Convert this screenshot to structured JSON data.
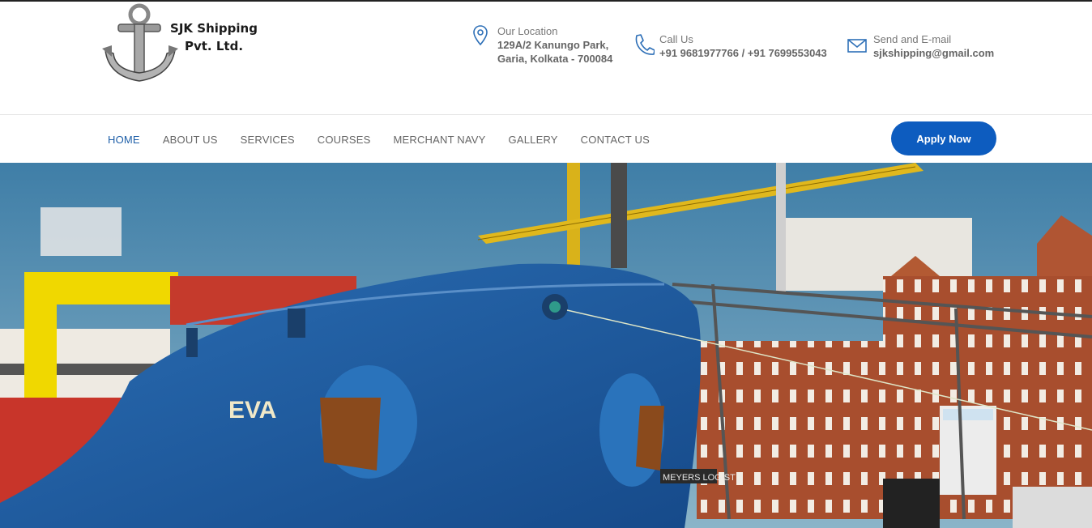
{
  "brand": {
    "line1": "SJK Shipping",
    "line2": "Pvt. Ltd."
  },
  "contacts": [
    {
      "icon": "location-pin-icon",
      "label": "Our Location",
      "value_lines": [
        "129A/2 Kanungo Park,",
        "Garia, Kolkata - 700084"
      ]
    },
    {
      "icon": "phone-icon",
      "label": "Call Us",
      "value_lines": [
        "+91 9681977766 / +91 7699553043"
      ]
    },
    {
      "icon": "mail-icon",
      "label": "Send and E-mail",
      "value_lines": [
        "sjkshipping@gmail.com"
      ]
    }
  ],
  "nav": {
    "items": [
      "HOME",
      "ABOUT US",
      "SERVICES",
      "COURSES",
      "MERCHANT NAVY",
      "GALLERY",
      "CONTACT US"
    ],
    "active_index": 0,
    "apply_label": "Apply Now"
  },
  "hero": {
    "ship_name": "EVA",
    "sign_text": "MEYERS LOGIST"
  },
  "colors": {
    "accent": "#0d5cbf",
    "active_nav": "#1e5fa8",
    "hull": "#1f5fa6",
    "sky": "#4f88ad",
    "brick": "#a85030"
  }
}
